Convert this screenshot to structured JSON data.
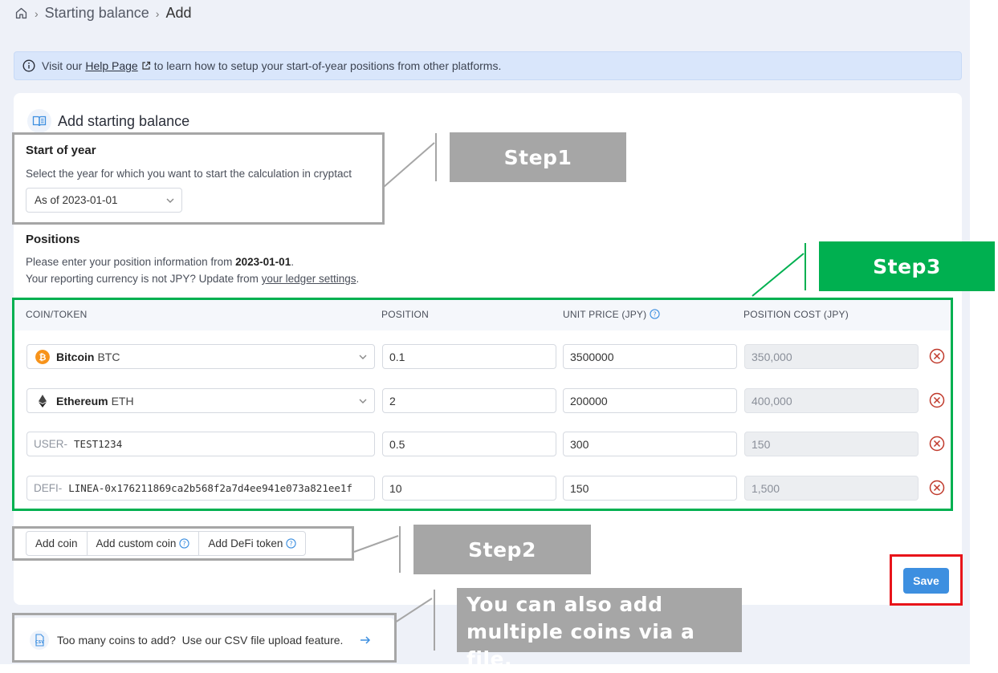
{
  "breadcrumb": {
    "items": [
      "Starting balance",
      "Add"
    ],
    "separator": "›"
  },
  "banner": {
    "prefix": "Visit our",
    "link": "Help Page",
    "suffix": "to learn how to setup your start-of-year positions from other platforms."
  },
  "card": {
    "title": "Add starting balance",
    "start_of_year": {
      "title": "Start of year",
      "description": "Select the year for which you want to start the calculation in cryptact",
      "selected": "As of 2023-01-01"
    },
    "positions": {
      "title": "Positions",
      "line1_prefix": "Please enter your position information from ",
      "line1_date": "2023-01-01",
      "line1_suffix": ".",
      "line2_prefix": "Your reporting currency is not JPY? Update from ",
      "line2_link": "your ledger settings",
      "line2_suffix": "."
    },
    "table": {
      "headers": [
        "COIN/TOKEN",
        "POSITION",
        "UNIT PRICE (JPY)",
        "POSITION COST (JPY)"
      ],
      "rows": [
        {
          "name": "Bitcoin",
          "symbol": "BTC",
          "position": "0.1",
          "unit_price": "3500000",
          "cost": "350,000"
        },
        {
          "name": "Ethereum",
          "symbol": "ETH",
          "position": "2",
          "unit_price": "200000",
          "cost": "400,000"
        },
        {
          "prefix": "USER-",
          "value": "TEST1234",
          "position": "0.5",
          "unit_price": "300",
          "cost": "150"
        },
        {
          "prefix": "DEFI-",
          "value": "LINEA-0x176211869ca2b568f2a7d4ee941e073a821ee1f",
          "position": "10",
          "unit_price": "150",
          "cost": "1,500"
        }
      ]
    },
    "buttons": {
      "add_coin": "Add coin",
      "add_custom": "Add custom coin",
      "add_defi": "Add DeFi token",
      "save": "Save"
    }
  },
  "csv": {
    "text": "Too many coins to add?  Use our CSV file upload feature.",
    "icon_label": "CSV"
  },
  "annotations": {
    "step1": "Step1",
    "step2": "Step2",
    "step3": "Step3",
    "file_note": "You can also add\nmultiple coins via a file."
  },
  "colors": {
    "primary": "#3d8fe0",
    "annotation_gray": "#a6a6a6",
    "annotation_green": "#00b050",
    "annotation_red": "#e8141a",
    "bitcoin": "#f7931a",
    "remove": "#c0392b"
  }
}
